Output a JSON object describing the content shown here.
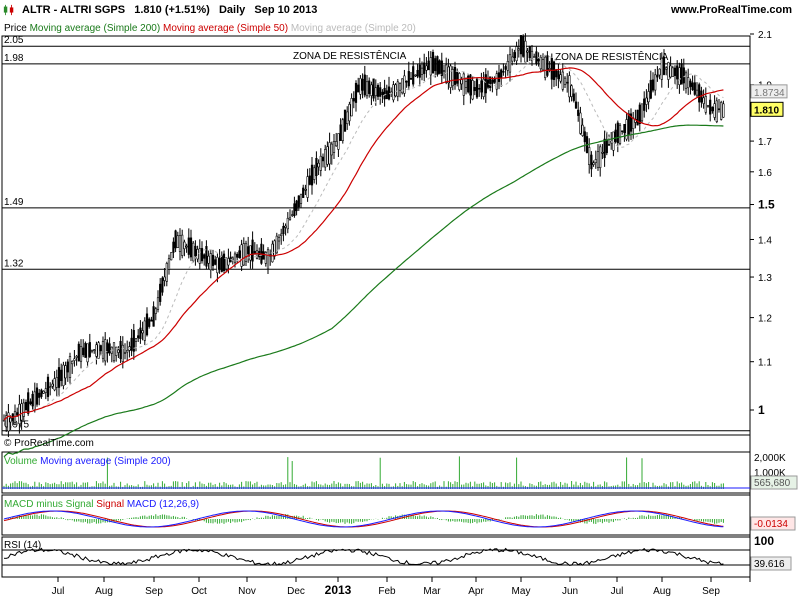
{
  "header": {
    "title": "ALTR - ALTRI SGPS",
    "price": "1.810 (+1.51%)",
    "period": "Daily",
    "date": "Sep 10 2013",
    "site": "www.ProRealTime.com"
  },
  "legend": {
    "price": "Price",
    "ma200": "Moving average (Simple 200)",
    "ma50": "Moving average (Simple 50)",
    "ma20": "Moving average (Simple 20)"
  },
  "copyright": "© ProRealTime.com",
  "volume_panel": {
    "label": "Volume",
    "ma_label": "Moving average (Simple 200)",
    "ticks": [
      "2,000K",
      "1,000K"
    ],
    "value_badge": "565,680"
  },
  "macd_panel": {
    "label": "MACD minus Signal",
    "signal_label": "Signal",
    "macd_label": "MACD",
    "params": "(12,26,9)",
    "value_badge": "-0.0134"
  },
  "rsi_panel": {
    "label": "RSI (14)",
    "ticks": [
      "100"
    ],
    "value_badge": "39.616"
  },
  "colors": {
    "ma200": "#1a7a1a",
    "ma50": "#cc0000",
    "ma20": "#bbbbbb",
    "volume": "#33aa33",
    "macd_line": "#1a1aff",
    "signal_line": "#cc0000",
    "badge": "#ffff66"
  },
  "chart_data": {
    "type": "candlestick",
    "x_ticks": [
      "Jul",
      "Aug",
      "Sep",
      "Oct",
      "Nov",
      "Dec",
      "2013",
      "Feb",
      "Mar",
      "Apr",
      "May",
      "Jun",
      "Jul",
      "Aug",
      "Sep"
    ],
    "y_ticks": [
      "2.1",
      "1.9",
      "1.8",
      "1.7",
      "1.6",
      "1.5",
      "1.4",
      "1.3",
      "1.2",
      "1.1",
      "1"
    ],
    "ylim": [
      0.95,
      2.12
    ],
    "y_scale": "log",
    "last_price": "1.810",
    "ma_badge": "1.8734",
    "levels": [
      {
        "value": 2.05,
        "label": "2.05"
      },
      {
        "value": 1.98,
        "label": "1.98"
      },
      {
        "value": 1.49,
        "label": "1.49"
      },
      {
        "value": 1.32,
        "label": "1.32"
      },
      {
        "value": 0.96,
        "label": "0.975"
      }
    ],
    "annotations": [
      "ZONA DE RESISTÊNCIA",
      "ZONA DE RESISTÊNCIA"
    ],
    "price_path": [
      [
        "Jun",
        0.98
      ],
      [
        "Jul",
        1.06
      ],
      [
        "Jul",
        1.12
      ],
      [
        "Aug",
        1.13
      ],
      [
        "Aug",
        1.12
      ],
      [
        "Sep",
        1.2
      ],
      [
        "Sep",
        1.4
      ],
      [
        "Oct",
        1.36
      ],
      [
        "Oct",
        1.33
      ],
      [
        "Nov",
        1.37
      ],
      [
        "Nov",
        1.35
      ],
      [
        "Dec",
        1.49
      ],
      [
        "Dec",
        1.62
      ],
      [
        "Jan",
        1.7
      ],
      [
        "Jan",
        1.9
      ],
      [
        "Feb",
        1.86
      ],
      [
        "Mar",
        1.98
      ],
      [
        "Apr",
        1.88
      ],
      [
        "Apr",
        1.92
      ],
      [
        "May",
        2.05
      ],
      [
        "May",
        1.98
      ],
      [
        "Jun",
        1.9
      ],
      [
        "Jun",
        1.62
      ],
      [
        "Jul",
        1.72
      ],
      [
        "Jul",
        1.78
      ],
      [
        "Aug",
        1.97
      ],
      [
        "Aug",
        1.93
      ],
      [
        "Sep",
        1.81
      ]
    ]
  }
}
